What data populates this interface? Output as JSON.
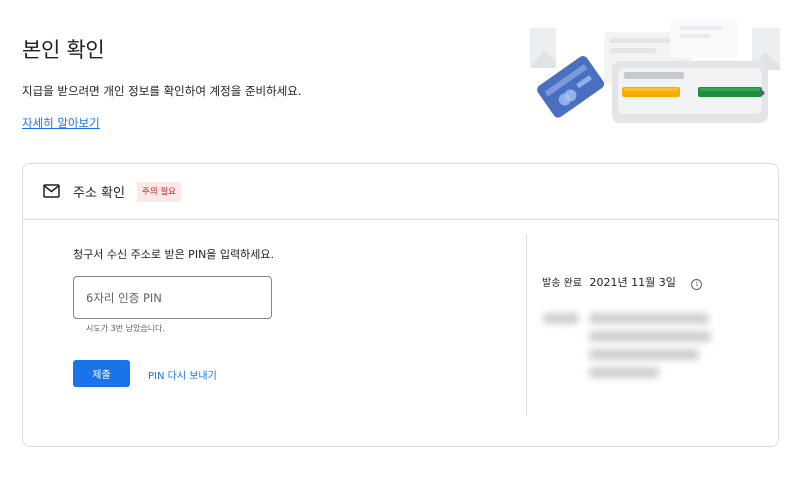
{
  "page": {
    "title": "본인 확인",
    "description": "지급을 받으려면 개인 정보를 확인하여 계정을 준비하세요.",
    "learn_more": "자세히 알아보기"
  },
  "card": {
    "title": "주소 확인",
    "badge": "주의 필요",
    "prompt": "청구서 수신 주소로 받은 PIN을 입력하세요.",
    "pin_placeholder": "6자리 인증 PIN",
    "helper": "시도가 3번 남았습니다.",
    "submit_label": "제출",
    "resend_label": "PIN 다시 보내기",
    "sent_label": "발송 완료",
    "sent_date": "2021년 11월 3일",
    "info_glyph": "i"
  },
  "icons": {
    "mail": "mail-icon",
    "info": "info-icon"
  },
  "colors": {
    "accent": "#1a73e8",
    "badge_bg": "#fce8e6",
    "badge_text": "#c5221f",
    "card_blue": "#4a6fc0",
    "yellow": "#f9ab00",
    "green": "#1e8e3e"
  }
}
